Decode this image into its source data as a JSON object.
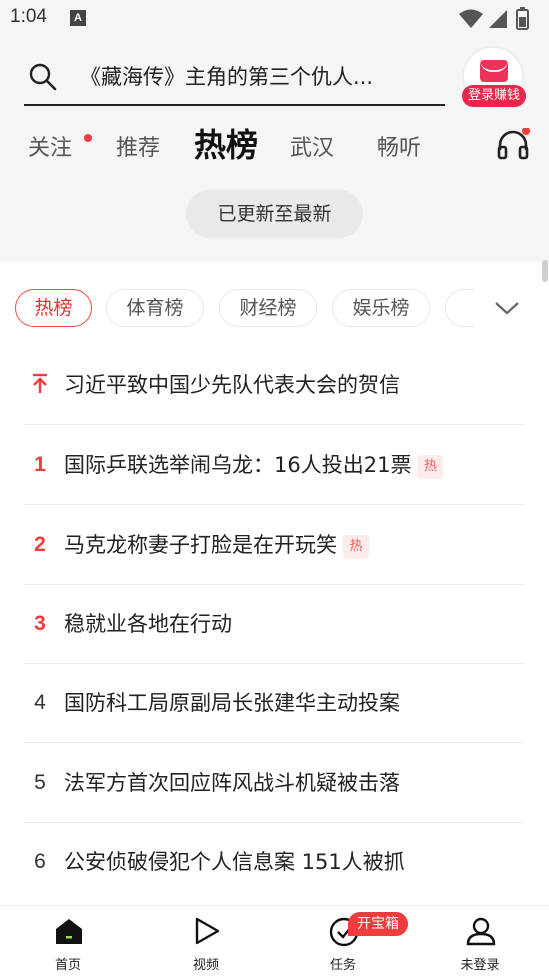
{
  "status_bar": {
    "time": "1:04",
    "notification_letter": "A"
  },
  "search": {
    "query": "《藏海传》主角的第三个仇人..."
  },
  "login": {
    "label": "登录赚钱"
  },
  "channels": [
    "关注",
    "推荐",
    "热榜",
    "武汉",
    "畅听"
  ],
  "active_channel": "热榜",
  "update_notice": "已更新至最新",
  "rank_tabs": [
    "热榜",
    "体育榜",
    "财经榜",
    "娱乐榜"
  ],
  "news": [
    {
      "rank": "",
      "pinned": true,
      "title": "习近平致中国少先队代表大会的贺信",
      "hot": ""
    },
    {
      "rank": "1",
      "pinned": false,
      "title": "国际乒联选举闹乌龙：16人投出21票",
      "hot": "热"
    },
    {
      "rank": "2",
      "pinned": false,
      "title": "马克龙称妻子打脸是在开玩笑",
      "hot": "热"
    },
    {
      "rank": "3",
      "pinned": false,
      "title": "稳就业各地在行动",
      "hot": ""
    },
    {
      "rank": "4",
      "pinned": false,
      "title": "国防科工局原副局长张建华主动投案",
      "hot": ""
    },
    {
      "rank": "5",
      "pinned": false,
      "title": "法军方首次回应阵风战斗机疑被击落",
      "hot": ""
    },
    {
      "rank": "6",
      "pinned": false,
      "title": "公安侦破侵犯个人信息案 151人被抓",
      "hot": ""
    }
  ],
  "bottom_nav": [
    {
      "label": "首页",
      "icon": "home-icon"
    },
    {
      "label": "视频",
      "icon": "play-icon"
    },
    {
      "label": "任务",
      "icon": "task-check-icon"
    },
    {
      "label": "未登录",
      "icon": "user-icon"
    }
  ],
  "treasure_badge": "开宝箱",
  "colors": {
    "accent_red": "#f03c3c",
    "badge_red": "#e8284a",
    "top_background": "#f5f5f7"
  }
}
